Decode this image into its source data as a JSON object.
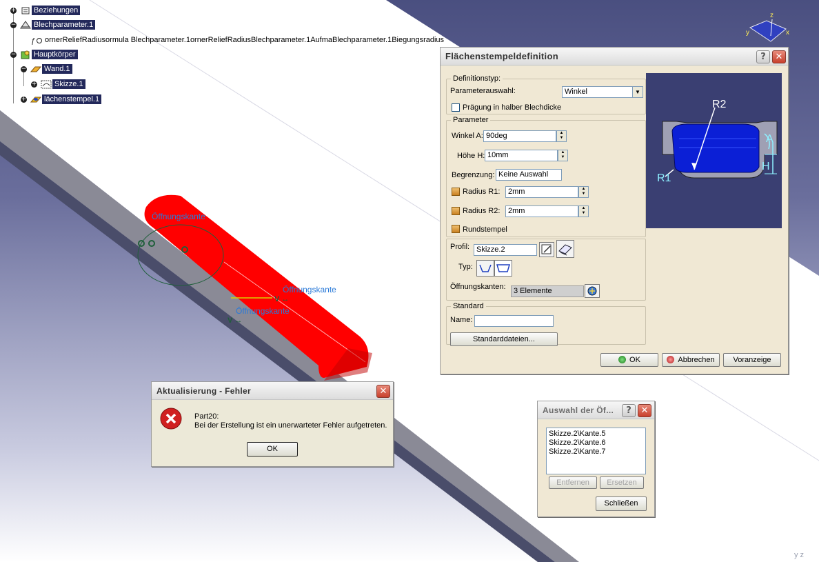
{
  "colors": {
    "tree_highlight": "#23295b",
    "part_red": "#ff0000",
    "dialog_bg": "#f0e8d4",
    "preview_blue": "#0b1fd6",
    "preview_bg": "#3a3f72"
  },
  "tree": {
    "items": [
      {
        "label": "Beziehungen",
        "toggle": "+",
        "icon": "relations-icon"
      },
      {
        "label": "Blechparameter.1",
        "toggle": "−",
        "icon": "sheetmetal-params-icon"
      },
      {
        "label": "ornerReliefRadiusormula Blechparameter.1ornerReliefRadiusBlechparameter.1AufmaBlechparameter.1Biegungsradius",
        "toggle": "",
        "icon": "formula-icon"
      },
      {
        "label": "Hauptkörper",
        "toggle": "−",
        "icon": "partbody-icon"
      },
      {
        "label": "Wand.1",
        "toggle": "−",
        "icon": "wall-icon"
      },
      {
        "label": "Skizze.1",
        "toggle": "+",
        "icon": "sketch-icon"
      },
      {
        "label": "lächenstempel.1",
        "toggle": "+",
        "icon": "surface-stamp-icon"
      }
    ]
  },
  "viewport": {
    "annotations": [
      "Öffnungskante",
      "Öffnungskante",
      "Öffnungskante"
    ],
    "compass_axes": [
      "z",
      "y",
      "x"
    ],
    "corner_axes": "y  z"
  },
  "stamp_dialog": {
    "title": "Flächenstempeldefinition",
    "help": "?",
    "close": "✕",
    "definition_group": "Definitionstyp:",
    "param_select_label": "Parameterauswahl:",
    "param_select_value": "Winkel",
    "half_thickness_label": "Prägung in halber Blechdicke",
    "params_group": "Parameter",
    "angle_label": "Winkel A:",
    "angle_value": "90deg",
    "height_label": "Höhe H:",
    "height_value": "10mm",
    "limit_label": "Begrenzung:",
    "limit_value": "Keine Auswahl",
    "r1_label": "Radius R1:",
    "r1_value": "2mm",
    "r2_label": "Radius R2:",
    "r2_value": "2mm",
    "round_label": "Rundstempel",
    "profile_label": "Profil:",
    "profile_value": "Skizze.2",
    "type_label": "Typ:",
    "open_edges_label": "Öffnungskanten:",
    "open_edges_value": "3 Elemente",
    "standard_group": "Standard",
    "name_label": "Name:",
    "name_value": "",
    "standard_files_button": "Standarddateien...",
    "ok_button": "OK",
    "cancel_button": "Abbrechen",
    "preview_button": "Voranzeige",
    "preview_labels": {
      "r1": "R1",
      "r2": "R2",
      "a": "A",
      "h": "H"
    }
  },
  "error_dialog": {
    "title": "Aktualisierung - Fehler",
    "close": "✕",
    "line1": "Part20:",
    "line2": "Bei der Erstellung ist ein unerwarteter Fehler aufgetreten.",
    "ok_button": "OK"
  },
  "edge_dialog": {
    "title": "Auswahl der Öf...",
    "help": "?",
    "close": "✕",
    "items": [
      "Skizze.2\\Kante.5",
      "Skizze.2\\Kante.6",
      "Skizze.2\\Kante.7"
    ],
    "remove_button": "Entfernen",
    "replace_button": "Ersetzen",
    "close_button": "Schließen"
  }
}
